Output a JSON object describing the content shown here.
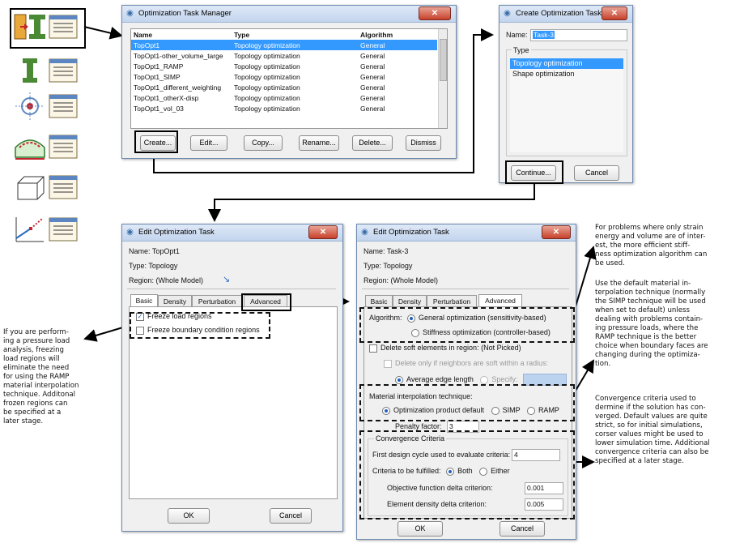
{
  "icon_column": {
    "icons": [
      "topology-optimization-task-icon",
      "stiffness-task-icon",
      "load-region-icon",
      "boundary-condition-icon",
      "box-model-icon",
      "design-response-icon"
    ]
  },
  "task_manager": {
    "title": "Optimization Task Manager",
    "columns": [
      "Name",
      "Type",
      "Algorithm"
    ],
    "rows": [
      {
        "name": "TopOpt1",
        "type": "Topology optimization",
        "algorithm": "General"
      },
      {
        "name": "TopOpt1-other_volume_targe",
        "type": "Topology optimization",
        "algorithm": "General"
      },
      {
        "name": "TopOpt1_RAMP",
        "type": "Topology optimization",
        "algorithm": "General"
      },
      {
        "name": "TopOpt1_SIMP",
        "type": "Topology optimization",
        "algorithm": "General"
      },
      {
        "name": "TopOpt1_different_weighting",
        "type": "Topology optimization",
        "algorithm": "General"
      },
      {
        "name": "TopOpt1_otherX-disp",
        "type": "Topology optimization",
        "algorithm": "General"
      },
      {
        "name": "TopOpt1_vol_03",
        "type": "Topology optimization",
        "algorithm": "General"
      }
    ],
    "buttons": {
      "create": "Create...",
      "edit": "Edit...",
      "copy": "Copy...",
      "rename": "Rename...",
      "delete": "Delete...",
      "dismiss": "Dismiss"
    }
  },
  "create_task": {
    "title": "Create Optimization Task",
    "name_label": "Name:",
    "name_value": "Task-3",
    "type_label": "Type",
    "types": [
      "Topology optimization",
      "Shape optimization"
    ],
    "continue": "Continue...",
    "cancel": "Cancel"
  },
  "edit_left": {
    "title": "Edit Optimization Task",
    "name_line": "Name:  TopOpt1",
    "type_line": "Type:   Topology",
    "region_line": "Region:  (Whole Model)",
    "tabs": [
      "Basic",
      "Density",
      "Perturbation",
      "Advanced"
    ],
    "freeze_load": "Freeze load regions",
    "freeze_bc": "Freeze boundary condition regions",
    "ok": "OK",
    "cancel": "Cancel"
  },
  "edit_right": {
    "title": "Edit Optimization Task",
    "name_line": "Name:  Task-3",
    "type_line": "Type:   Topology",
    "region_line": "Region:  (Whole Model)",
    "tabs": [
      "Basic",
      "Density",
      "Perturbation",
      "Advanced"
    ],
    "algorithm_label": "Algorithm:",
    "alg_general": "General optimization (sensitivity-based)",
    "alg_stiffness": "Stiffness optimization (controller-based)",
    "soft_elements": "Delete soft elements in region:  (Not Picked)",
    "soft_neighbors": "Delete only if neighbors are soft within a radius:",
    "avg_edge": "Average edge length",
    "specify": "Specify:",
    "material_label": "Material interpolation technique:",
    "mat_default": "Optimization product default",
    "mat_simp": "SIMP",
    "mat_ramp": "RAMP",
    "penalty_label": "Penalty factor:",
    "penalty_value": "3",
    "convergence_label": "Convergence Criteria",
    "first_cycle_label": "First design cycle used to evaluate criteria:",
    "first_cycle_value": "4",
    "criteria_label": "Criteria to be fulfilled:",
    "crit_both": "Both",
    "crit_either": "Either",
    "objective_label": "Objective function delta criterion:",
    "objective_value": "0.001",
    "density_label": "Element density delta criterion:",
    "density_value": "0.005",
    "ok": "OK",
    "cancel": "Cancel"
  },
  "notes": {
    "left": [
      "If you are perform-",
      "ing a pressure load",
      "analysis, freezing",
      "load regions will",
      "eliminate the need",
      "for using the RAMP",
      "material interpolation",
      "technique. Additonal",
      "frozen regions can",
      "be specified at a",
      "later stage."
    ],
    "right_top": [
      "For problems where only strain",
      "energy and volume are of inter-",
      "est, the more efficient stiff-",
      "ness optimization algorithm can",
      "be used."
    ],
    "right_mid": [
      "Use the default material in-",
      "terpolation technique (normally",
      "the SIMP technique will be used",
      "when set to default) unless",
      "dealing with problems contain-",
      "ing pressure loads, where the",
      "RAMP technique is the better",
      "choice when boundary faces are",
      "changing during the optimiza-",
      "tion."
    ],
    "right_bottom": [
      "Convergence criteria used to",
      "dermine if the solution has con-",
      "verged. Default values are quite",
      "strict, so for initial simulations,",
      "corser values might be used to",
      "lower simulation time. Additional",
      "convergence criteria can also be",
      "specified at a later stage."
    ]
  },
  "colors": {
    "selection": "#3399ff",
    "accent": "#1f5fbf"
  }
}
